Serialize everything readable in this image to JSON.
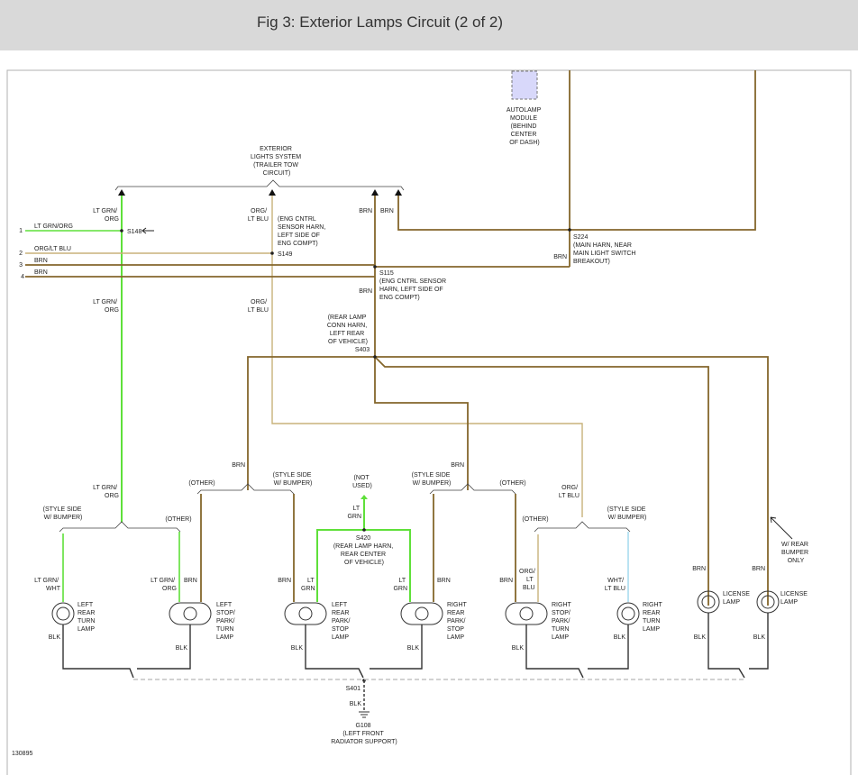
{
  "header": {
    "title": "Fig 3: Exterior Lamps Circuit (2 of 2)"
  },
  "colors": {
    "brn": "#84662b",
    "ltgrn": "#5fe03a",
    "orgltblu": "#c8b27a",
    "whtltblu": "#a8dcef",
    "blk": "#333333",
    "ground_dash": "#b8b8b8",
    "module_fill": "#d8d8fa"
  },
  "labels": {
    "module": [
      "AUTOLAMP",
      "MODULE",
      "(BEHIND",
      "CENTER",
      "OF DASH)"
    ],
    "exterior": [
      "EXTERIOR",
      "LIGHTS SYSTEM",
      "(TRAILER TOW",
      "CIRCUIT)"
    ],
    "pins": [
      "1",
      "2",
      "3",
      "4"
    ],
    "pin_wires": [
      "LT GRN/ORG",
      "ORG/LT BLU",
      "BRN",
      "BRN"
    ],
    "ltgrn_org": [
      "LT GRN/",
      "ORG"
    ],
    "org_ltblu": [
      "ORG/",
      "LT BLU"
    ],
    "brn": "BRN",
    "blk": "BLK",
    "s148": "S148",
    "s149": "S149",
    "eng_cntrl": [
      "(ENG CNTRL",
      "SENSOR HARN,",
      "LEFT SIDE OF",
      "ENG COMPT)"
    ],
    "s224": [
      "S224",
      "(MAIN HARN, NEAR",
      "MAIN LIGHT SWITCH",
      "BREAKOUT)"
    ],
    "s115": [
      "S115",
      "(ENG CNTRL SENSOR",
      "HARN, LEFT SIDE OF",
      "ENG COMPT)"
    ],
    "rear_conn": [
      "(REAR LAMP",
      "CONN HARN,",
      "LEFT REAR",
      "OF VEHICLE)"
    ],
    "s403": "S403",
    "other": "(OTHER)",
    "style_side": [
      "(STYLE SIDE",
      "W/ BUMPER)"
    ],
    "not_used": [
      "(NOT",
      "USED)"
    ],
    "lt_grn": [
      "LT",
      "GRN"
    ],
    "s420": [
      "S420",
      "(REAR LAMP HARN,",
      "REAR CENTER",
      "OF VEHICLE)"
    ],
    "org_lt_blu3": [
      "ORG/",
      "LT",
      "BLU"
    ],
    "wht_ltblu": [
      "WHT/",
      "LT BLU"
    ],
    "ltgrn_wht": [
      "LT GRN/",
      "WHT"
    ],
    "w_rear_bumper": [
      "W/ REAR",
      "BUMPER",
      "ONLY"
    ],
    "lamp_left_rear_turn": [
      "LEFT",
      "REAR",
      "TURN",
      "LAMP"
    ],
    "lamp_left_stop": [
      "LEFT",
      "STOP/",
      "PARK/",
      "TURN",
      "LAMP"
    ],
    "lamp_left_park": [
      "LEFT",
      "REAR",
      "PARK/",
      "STOP",
      "LAMP"
    ],
    "lamp_right_park": [
      "RIGHT",
      "REAR",
      "PARK/",
      "STOP",
      "LAMP"
    ],
    "lamp_right_stop": [
      "RIGHT",
      "STOP/",
      "PARK/",
      "TURN",
      "LAMP"
    ],
    "lamp_right_rear_turn": [
      "RIGHT",
      "REAR",
      "TURN",
      "LAMP"
    ],
    "lamp_license": [
      "LICENSE",
      "LAMP"
    ],
    "s401": "S401",
    "g108": [
      "G108",
      "(LEFT FRONT",
      "RADIATOR SUPPORT)"
    ],
    "figure_id": "130895"
  }
}
